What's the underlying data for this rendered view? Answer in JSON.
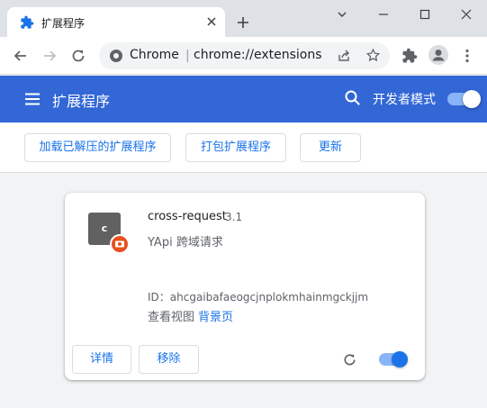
{
  "tab": {
    "title": "扩展程序"
  },
  "omnibox": {
    "scheme_label": "Chrome",
    "separator": "|",
    "url": "chrome://extensions"
  },
  "header": {
    "title": "扩展程序",
    "dev_mode_label": "开发者模式",
    "dev_mode_on": true
  },
  "actions": {
    "load_unpacked": "加载已解压的扩展程序",
    "pack": "打包扩展程序",
    "update": "更新"
  },
  "extension": {
    "icon_letter": "c",
    "name": "cross-request",
    "version": "3.1",
    "description": "YApi 跨域请求",
    "id_text": "ID：ahcgaibafaeogcjnplokmhainmgckjjm",
    "views_label": "查看视图",
    "views_link": "背景页",
    "details_label": "详情",
    "remove_label": "移除",
    "enabled": true
  },
  "colors": {
    "header": "#3367d6",
    "accent": "#1a73e8",
    "badge": "#e8501e"
  }
}
